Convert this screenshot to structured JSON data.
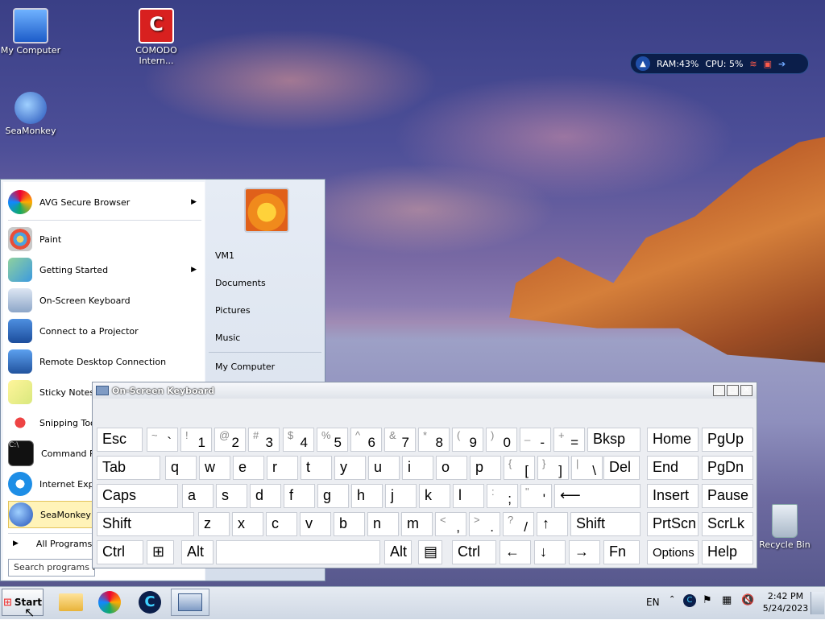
{
  "desktop": {
    "icons": [
      {
        "label": "My Computer"
      },
      {
        "label": "COMODO Intern..."
      },
      {
        "label": "SeaMonkey"
      },
      {
        "label": "Recycle Bin"
      }
    ]
  },
  "sysmon": {
    "ram": "RAM:43%",
    "cpu": "CPU: 5%"
  },
  "start_menu": {
    "programs": [
      {
        "label": "AVG Secure Browser",
        "submenu": true
      },
      {
        "label": "Paint",
        "submenu": false
      },
      {
        "label": "Getting Started",
        "submenu": true
      },
      {
        "label": "On-Screen Keyboard",
        "submenu": false
      },
      {
        "label": "Connect to a Projector",
        "submenu": false
      },
      {
        "label": "Remote Desktop Connection",
        "submenu": false
      },
      {
        "label": "Sticky Notes",
        "submenu": false
      },
      {
        "label": "Snipping Tool",
        "submenu": false
      },
      {
        "label": "Command Prompt",
        "submenu": false
      },
      {
        "label": "Internet Explorer",
        "submenu": false
      },
      {
        "label": "SeaMonkey",
        "submenu": false
      }
    ],
    "all_programs": "All Programs",
    "search_placeholder": "Search programs and files",
    "right_items": [
      "VM1",
      "Documents",
      "Pictures",
      "Music",
      "My Computer"
    ]
  },
  "osk": {
    "title": "On-Screen Keyboard",
    "rows": [
      [
        [
          "Esc",
          ""
        ],
        [
          "`",
          "~"
        ],
        [
          "1",
          "!"
        ],
        [
          "2",
          "@"
        ],
        [
          "3",
          "#"
        ],
        [
          "4",
          "$"
        ],
        [
          "5",
          "%"
        ],
        [
          "6",
          "^"
        ],
        [
          "7",
          "&"
        ],
        [
          "8",
          "*"
        ],
        [
          "9",
          "("
        ],
        [
          "0",
          ")"
        ],
        [
          "-",
          "_"
        ],
        [
          "=",
          "+"
        ],
        [
          "Bksp",
          ""
        ],
        [
          "Home",
          ""
        ],
        [
          "PgUp",
          ""
        ]
      ],
      [
        [
          "Tab",
          ""
        ],
        [
          "q",
          ""
        ],
        [
          "w",
          ""
        ],
        [
          "e",
          ""
        ],
        [
          "r",
          ""
        ],
        [
          "t",
          ""
        ],
        [
          "y",
          ""
        ],
        [
          "u",
          ""
        ],
        [
          "i",
          ""
        ],
        [
          "o",
          ""
        ],
        [
          "p",
          ""
        ],
        [
          "[",
          "{"
        ],
        [
          "]",
          "}"
        ],
        [
          "\\",
          "|"
        ],
        [
          "Del",
          ""
        ],
        [
          "End",
          ""
        ],
        [
          "PgDn",
          ""
        ]
      ],
      [
        [
          "Caps",
          ""
        ],
        [
          "a",
          ""
        ],
        [
          "s",
          ""
        ],
        [
          "d",
          ""
        ],
        [
          "f",
          ""
        ],
        [
          "g",
          ""
        ],
        [
          "h",
          ""
        ],
        [
          "j",
          ""
        ],
        [
          "k",
          ""
        ],
        [
          "l",
          ""
        ],
        [
          ";",
          ":"
        ],
        [
          "'",
          "\""
        ],
        [
          "⟵",
          ""
        ],
        [
          "Insert",
          ""
        ],
        [
          "Pause",
          ""
        ]
      ],
      [
        [
          "Shift",
          ""
        ],
        [
          "z",
          ""
        ],
        [
          "x",
          ""
        ],
        [
          "c",
          ""
        ],
        [
          "v",
          ""
        ],
        [
          "b",
          ""
        ],
        [
          "n",
          ""
        ],
        [
          "m",
          ""
        ],
        [
          ",",
          "<"
        ],
        [
          ".",
          ">"
        ],
        [
          "/",
          "?"
        ],
        [
          "↑",
          ""
        ],
        [
          "Shift",
          ""
        ],
        [
          "PrtScn",
          ""
        ],
        [
          "ScrLk",
          ""
        ]
      ],
      [
        [
          "Ctrl",
          ""
        ],
        [
          "⊞",
          ""
        ],
        [
          "Alt",
          ""
        ],
        [
          "",
          ""
        ],
        [
          "Alt",
          ""
        ],
        [
          "▤",
          ""
        ],
        [
          "Ctrl",
          ""
        ],
        [
          "←",
          ""
        ],
        [
          "↓",
          ""
        ],
        [
          "→",
          ""
        ],
        [
          "Fn",
          ""
        ],
        [
          "Options",
          ""
        ],
        [
          "Help",
          ""
        ]
      ]
    ]
  },
  "taskbar": {
    "start_label": "Start",
    "lang": "EN",
    "time": "2:42 PM",
    "date": "5/24/2023"
  }
}
